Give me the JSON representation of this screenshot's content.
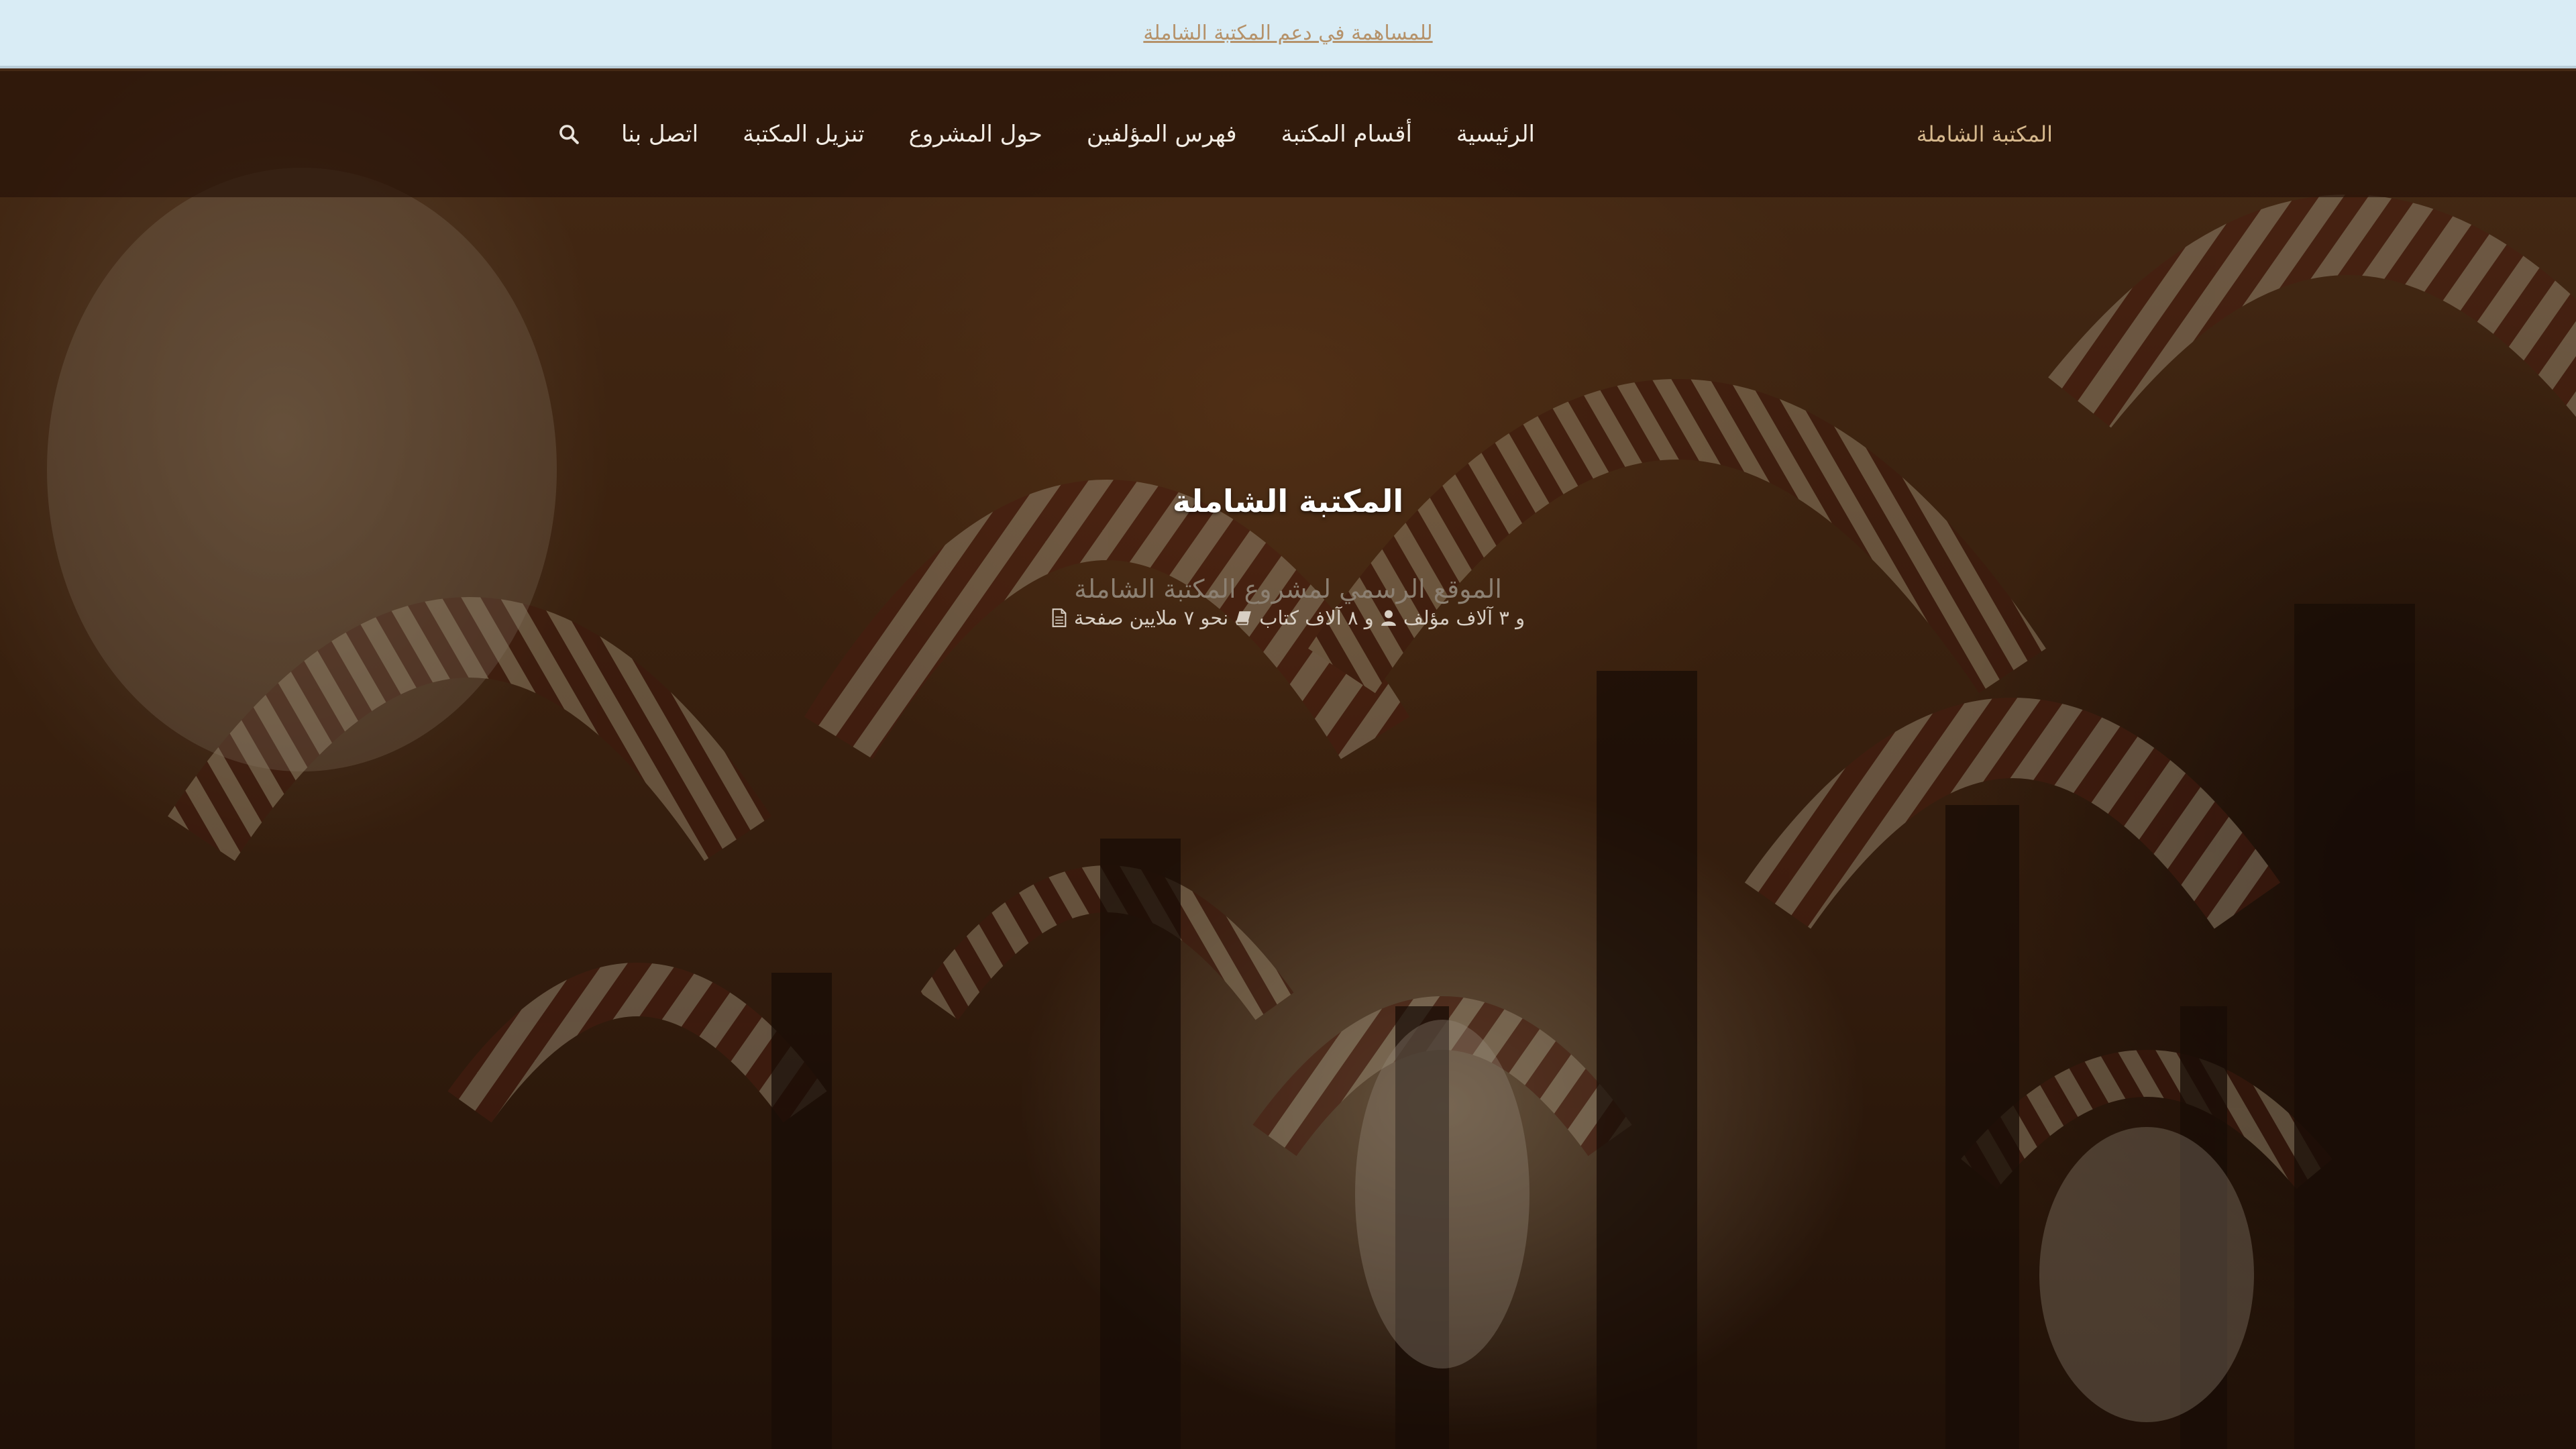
{
  "announcement": {
    "link_text": "للمساهمة في دعم المكتبة الشاملة"
  },
  "navbar": {
    "brand": "المكتبة الشاملة",
    "items": [
      {
        "label": "الرئيسية"
      },
      {
        "label": "أقسام المكتبة"
      },
      {
        "label": "فهرس المؤلفين"
      },
      {
        "label": "حول المشروع"
      },
      {
        "label": "تنزيل المكتبة"
      },
      {
        "label": "اتصل بنا"
      }
    ],
    "search_icon": "search-icon"
  },
  "hero": {
    "title": "المكتبة الشاملة",
    "subtitle": "الموقع الرسمي لمشروع المكتبة الشاملة",
    "stats": {
      "pages": "نحو ٧ ملايين صفحة",
      "books": "و ٨ آلاف كتاب",
      "authors": "و ٣ آلاف مؤلف",
      "pages_icon": "file-icon",
      "books_icon": "book-icon",
      "authors_icon": "user-icon"
    }
  },
  "colors": {
    "announce_bg": "#d9ecf5",
    "announce_link": "#b5926a",
    "navbar_bg": "#28140b",
    "brand": "#d6b88d",
    "nav_text": "#f2ece4",
    "hero_title": "#ffffff",
    "hero_subtitle": "#8c8072"
  }
}
